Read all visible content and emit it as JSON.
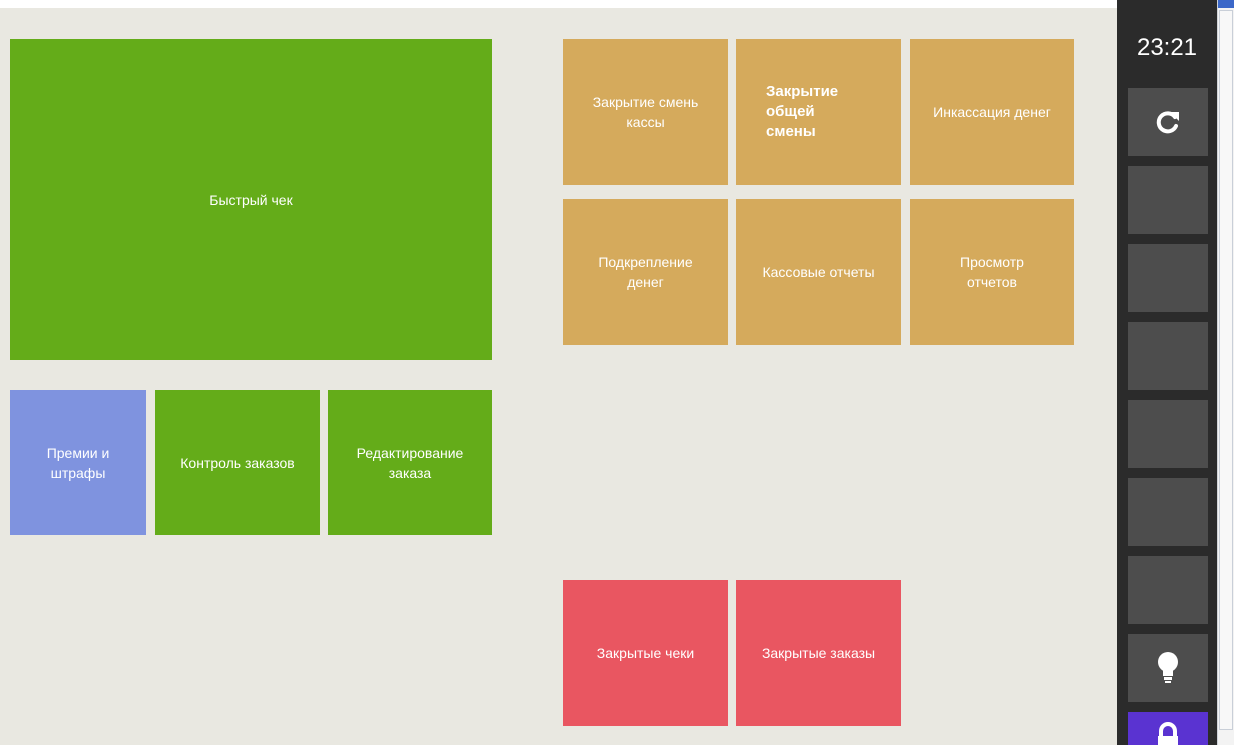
{
  "tiles": {
    "quick_check": "Быстрый чек",
    "bonuses_fines": "Премии и\nштрафы",
    "order_control": "Контроль заказов",
    "edit_order": "Редактирование\nзаказа",
    "close_register_shift": "Закрытие смень\nкассы",
    "close_general_shift": "Закрытие\nобщей\nсмены",
    "cash_collection": "Инкассация денег",
    "cash_reinforcement": "Подкрепление\nденег",
    "cash_reports": "Кассовые отчеты",
    "view_reports": "Просмотр\nотчетов",
    "closed_checks": "Закрытые чеки",
    "closed_orders": "Закрытые заказы"
  },
  "side_panel": {
    "time": "23:21",
    "buttons": [
      {
        "icon": "refresh-icon"
      },
      {
        "icon": ""
      },
      {
        "icon": ""
      },
      {
        "icon": ""
      },
      {
        "icon": ""
      },
      {
        "icon": ""
      },
      {
        "icon": ""
      },
      {
        "icon": "lightbulb-icon"
      },
      {
        "icon": "lock-icon"
      }
    ]
  },
  "colors": {
    "green": "#64ac19",
    "tan": "#d5aa5c",
    "blue": "#7f93df",
    "red": "#e95661",
    "panel": "#2b2b2b",
    "panel_button": "#4d4d4d",
    "lock_button": "#5a33d1"
  }
}
